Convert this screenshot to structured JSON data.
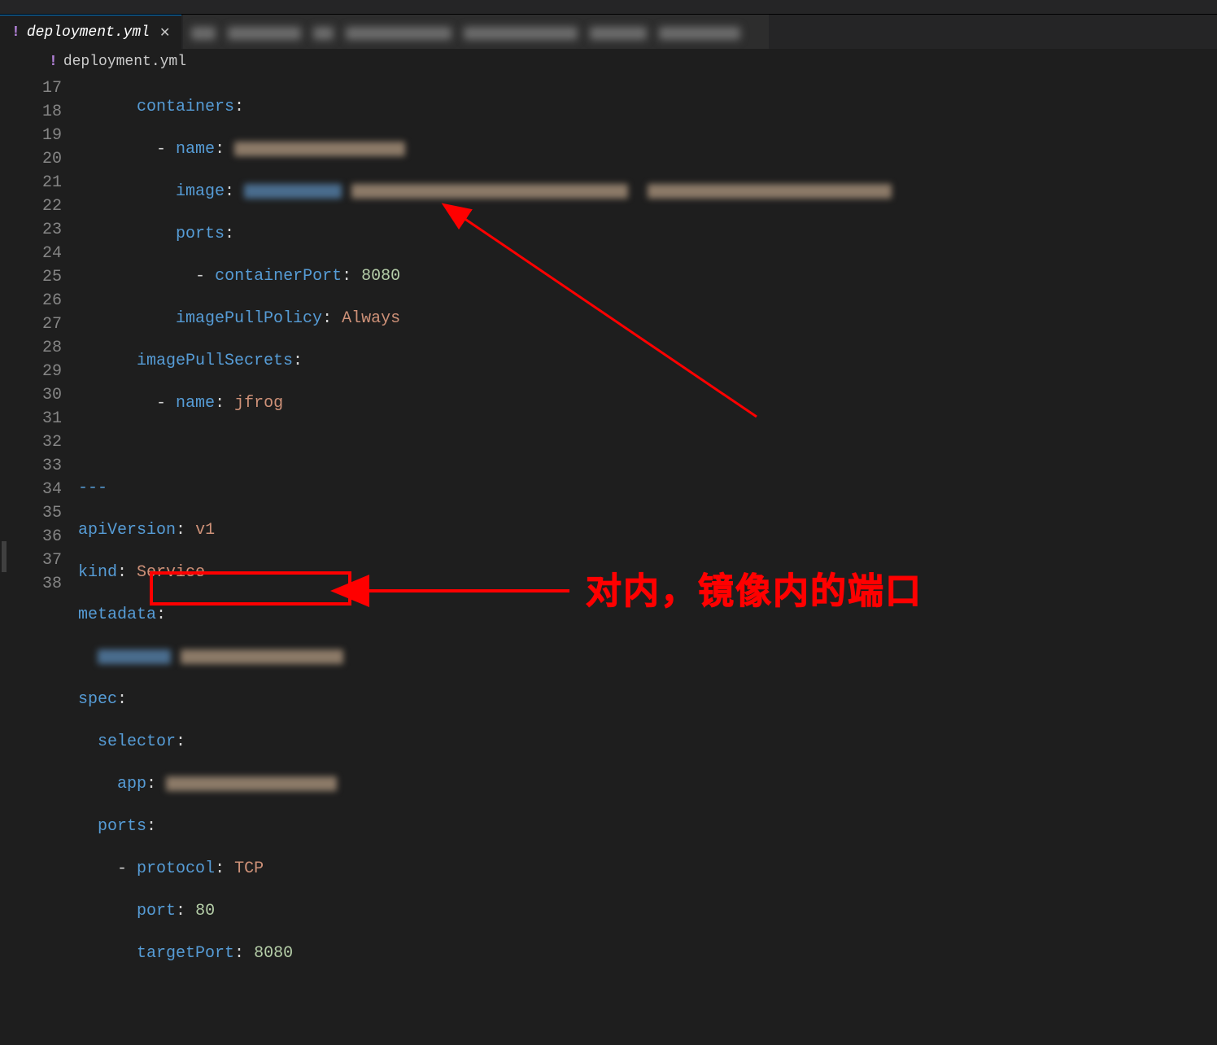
{
  "tabs": {
    "active": {
      "icon": "!",
      "label": "deployment.yml"
    },
    "breadcrumb": {
      "icon": "!",
      "label": "deployment.yml"
    }
  },
  "gutter": [
    "17",
    "18",
    "19",
    "20",
    "21",
    "22",
    "23",
    "24",
    "25",
    "26",
    "27",
    "28",
    "29",
    "30",
    "31",
    "32",
    "33",
    "34",
    "35",
    "36",
    "37",
    "38"
  ],
  "code": {
    "l17_key": "containers",
    "l18_key": "name",
    "l19_key": "image",
    "l20_key": "ports",
    "l21_key": "containerPort",
    "l21_val": "8080",
    "l22_key": "imagePullPolicy",
    "l22_val": "Always",
    "l23_key": "imagePullSecrets",
    "l24_key": "name",
    "l24_val": "jfrog",
    "l26_sep": "---",
    "l27_key": "apiVersion",
    "l27_val": "v1",
    "l28_key": "kind",
    "l28_val": "Service",
    "l29_key": "metadata",
    "l31_key": "spec",
    "l32_key": "selector",
    "l33_key": "app",
    "l34_key": "ports",
    "l35_key": "protocol",
    "l35_val": "TCP",
    "l36_key": "port",
    "l36_val": "80",
    "l37_key": "targetPort",
    "l37_val": "8080"
  },
  "annotation": "对内，镜像内的端口"
}
